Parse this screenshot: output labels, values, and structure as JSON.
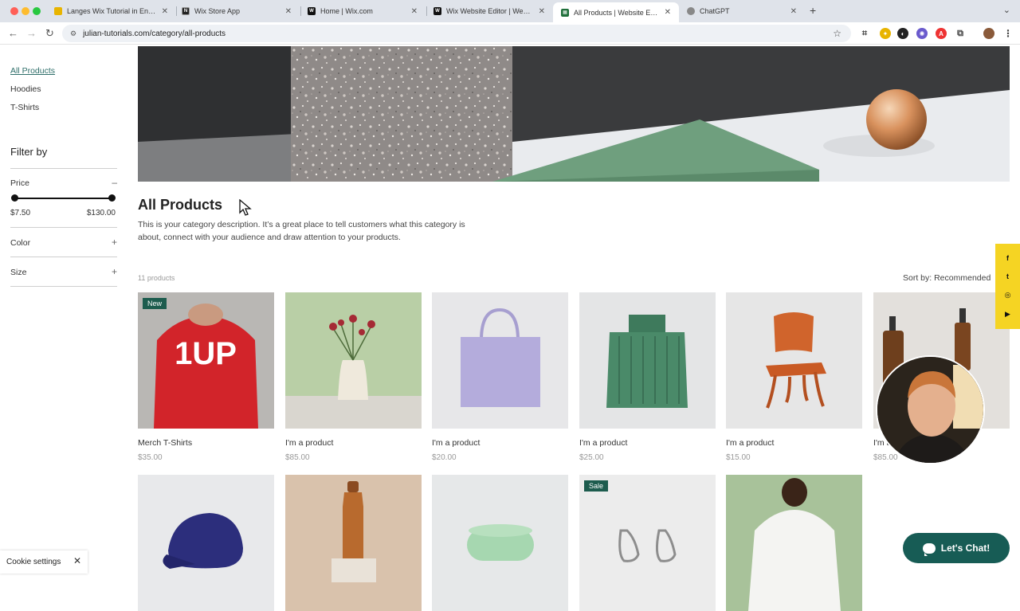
{
  "browser": {
    "tabs": [
      {
        "title": "Langes Wix Tutorial in Englisch",
        "favicon_color": "#e8b400"
      },
      {
        "title": "Wix Store App",
        "favicon_color": "#222222"
      },
      {
        "title": "Home | Wix.com",
        "favicon_color": "#111111"
      },
      {
        "title": "Wix Website Editor | Website",
        "favicon_color": "#111111"
      },
      {
        "title": "All Products | Website English",
        "favicon_color": "#1f6f3a"
      },
      {
        "title": "ChatGPT",
        "favicon_color": "#888888"
      }
    ],
    "url": "julian-tutorials.com/category/all-products"
  },
  "sidebar": {
    "categories": [
      "All Products",
      "Hoodies",
      "T-Shirts"
    ],
    "filter_title": "Filter by",
    "filters": [
      {
        "label": "Price",
        "toggle": "–"
      },
      {
        "label": "Color",
        "toggle": "+"
      },
      {
        "label": "Size",
        "toggle": "+"
      }
    ],
    "price_min": "$7.50",
    "price_max": "$130.00"
  },
  "main": {
    "title": "All Products",
    "description": "This is your category description. It’s a great place to tell customers what this category is about, connect with your audience and draw attention to your products.",
    "count": "11 products",
    "sort": "Sort by: Recommended"
  },
  "products": [
    {
      "name": "Merch T-Shirts",
      "price": "$35.00",
      "ribbon": "New"
    },
    {
      "name": "I'm a product",
      "price": "$85.00"
    },
    {
      "name": "I'm a product",
      "price": "$20.00"
    },
    {
      "name": "I'm a product",
      "price": "$25.00"
    },
    {
      "name": "I'm a product",
      "price": "$15.00"
    },
    {
      "name": "I'm a product",
      "price": "$85.00"
    },
    {
      "name": "",
      "price": ""
    },
    {
      "name": "",
      "price": ""
    },
    {
      "name": "",
      "price": ""
    },
    {
      "name": "",
      "price": "",
      "ribbon": "Sale"
    },
    {
      "name": "",
      "price": ""
    }
  ],
  "tshirt_print": "1UP",
  "cookie": {
    "label": "Cookie settings"
  },
  "chat": {
    "label": "Let's Chat!"
  },
  "colors": {
    "accent": "#2f6f6a",
    "chat": "#175c55",
    "ribbon": "#1d5c4e",
    "social": "#f5d423"
  }
}
